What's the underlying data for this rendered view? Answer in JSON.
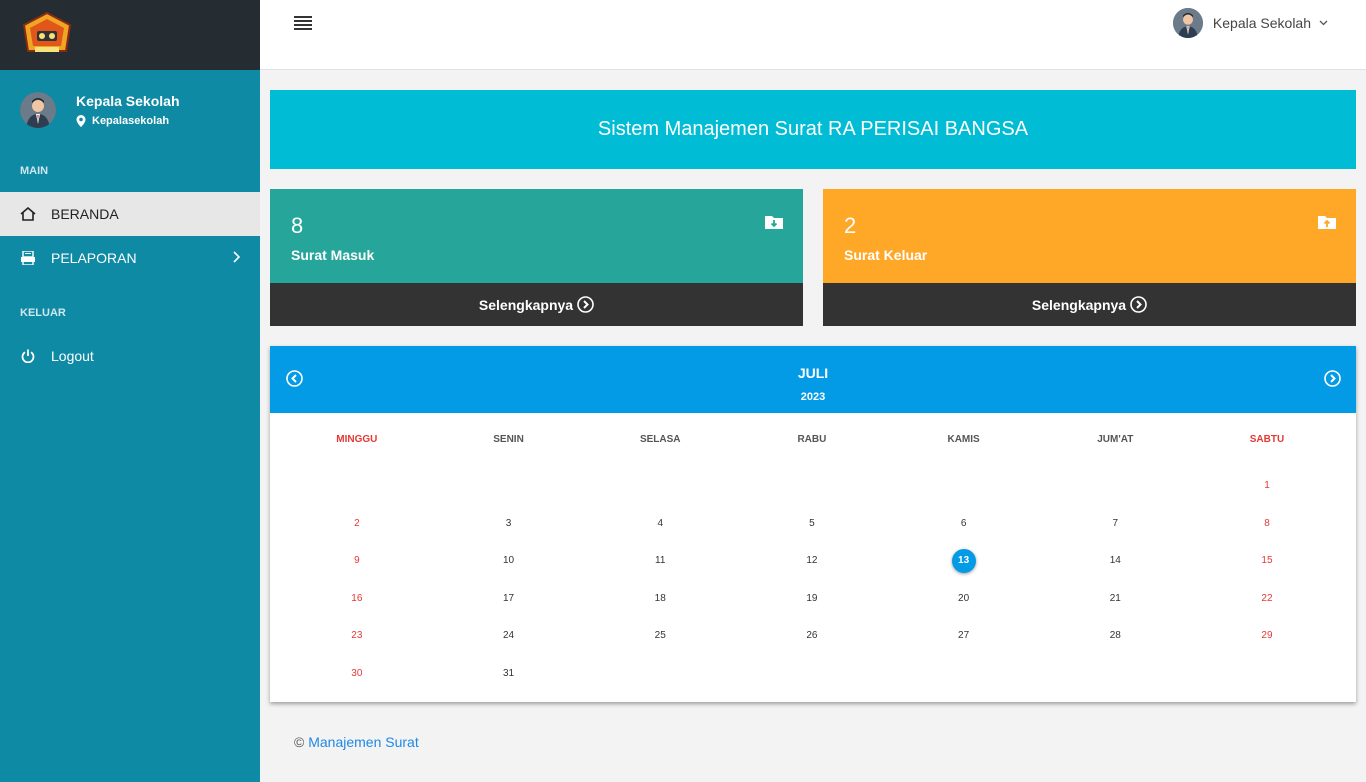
{
  "sidebar": {
    "user_name": "Kepala Sekolah",
    "user_role": "Kepalasekolah",
    "section_main": "MAIN",
    "items": [
      {
        "label": "BERANDA",
        "icon": "home-icon"
      },
      {
        "label": "PELAPORAN",
        "icon": "printer-icon"
      }
    ],
    "section_logout": "KELUAR",
    "logout_label": "Logout"
  },
  "topbar": {
    "user_name": "Kepala Sekolah"
  },
  "banner": {
    "title": "Sistem Manajemen Surat RA PERISAI BANGSA"
  },
  "cards": [
    {
      "count": "8",
      "label": "Surat Masuk",
      "link": "Selengkapnya",
      "color": "#26a69a",
      "icon": "folder-download-icon"
    },
    {
      "count": "2",
      "label": "Surat Keluar",
      "link": "Selengkapnya",
      "color": "#ffa726",
      "icon": "folder-upload-icon"
    }
  ],
  "calendar": {
    "month": "JULI",
    "year": "2023",
    "weekdays": [
      "MINGGU",
      "SENIN",
      "SELASA",
      "RABU",
      "KAMIS",
      "JUM'AT",
      "SABTU"
    ],
    "first_weekday_index": 6,
    "days_in_month": 31,
    "today": 13
  },
  "footer": {
    "copyright": "©",
    "link_text": "Manajemen Surat"
  },
  "colors": {
    "sidebar": "#0e8aa4",
    "banner": "#00bcd4",
    "calendar_header": "#039be5",
    "weekend": "#e53935"
  }
}
